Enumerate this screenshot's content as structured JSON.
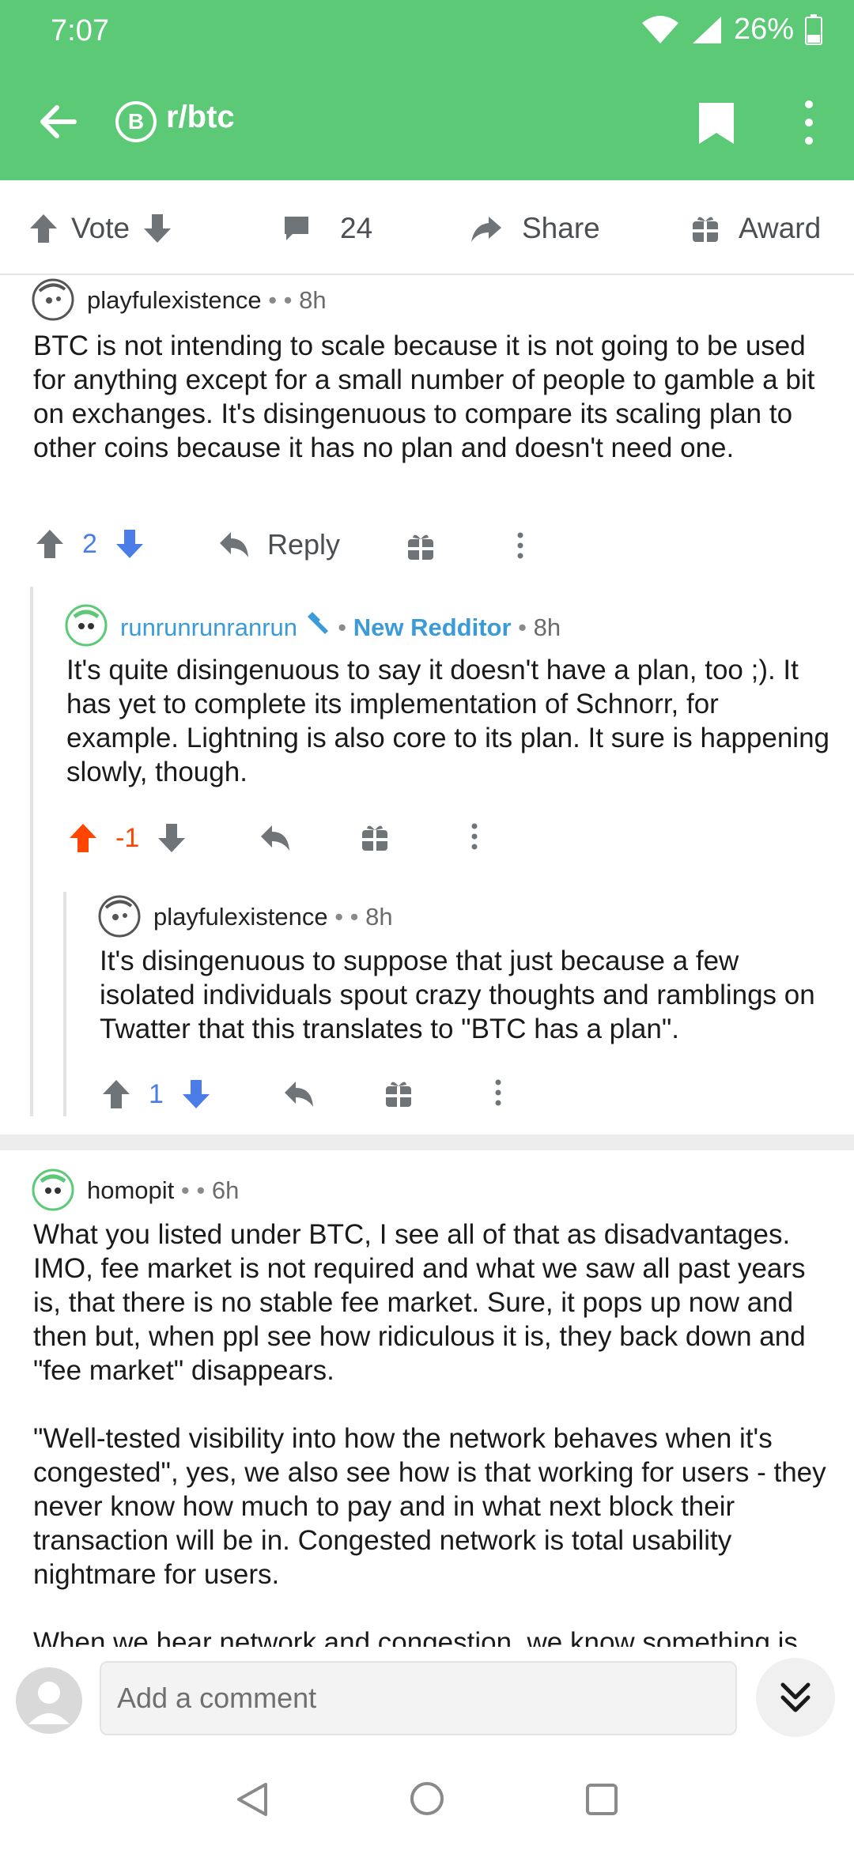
{
  "status_bar": {
    "time": "7:07",
    "battery": "26%"
  },
  "app_bar": {
    "subreddit": "r/btc",
    "subreddit_icon_letter": "B",
    "accent_color": "#5cc977"
  },
  "post_actions": {
    "vote_label": "Vote",
    "comment_count": "24",
    "share_label": "Share",
    "award_label": "Award"
  },
  "comments": [
    {
      "author": "playfulexistence",
      "flair": "",
      "time": "8h",
      "body": "BTC is not intending to scale because it is not going to be used for anything except for a small number of people to gamble a bit on exchanges. It's disingenuous to compare its scaling plan to other coins because it has no plan and doesn't need one.",
      "score": "2",
      "reply_label": "Reply",
      "vote_state": "none"
    },
    {
      "author": "runrunrunranrun",
      "flair": "New Redditor",
      "time": "8h",
      "body": "It's quite disingenuous to say it doesn't have a plan, too ;). It has yet to complete its implementation of Schnorr, for example.  Lightning is also core to its plan.  It sure is happening slowly, though.",
      "score": "-1",
      "vote_state": "up"
    },
    {
      "author": "playfulexistence",
      "flair": "",
      "time": "8h",
      "body": "It's disingenuous to suppose that just because a few isolated individuals spout crazy thoughts and ramblings on Twatter that this translates to \"BTC has a plan\".",
      "score": "1",
      "vote_state": "none"
    },
    {
      "author": "homopit",
      "flair": "",
      "time": "6h",
      "body_paragraphs": [
        "What you listed under BTC, I see all of that as disadvantages. IMO, fee market is not required and what we saw all past years is, that there is no stable fee market. Sure, it pops up now and then but, when ppl see how ridiculous it is, they back down and \"fee market\" disappears.",
        "\"Well-tested visibility into how the network behaves when it's congested\", yes, we also see how is that working for users - they never know how much to pay and in what next block their transaction will be in. Congested network is total usability nightmare for users.",
        "When we hear network and congestion, we know something is"
      ]
    }
  ],
  "comment_bar": {
    "placeholder": "Add a comment"
  },
  "colors": {
    "upvote_active": "#ff4500",
    "downvote_active": "#4a7de8",
    "score_blue": "#4a7de8",
    "flair_blue": "#3a9bd8"
  }
}
